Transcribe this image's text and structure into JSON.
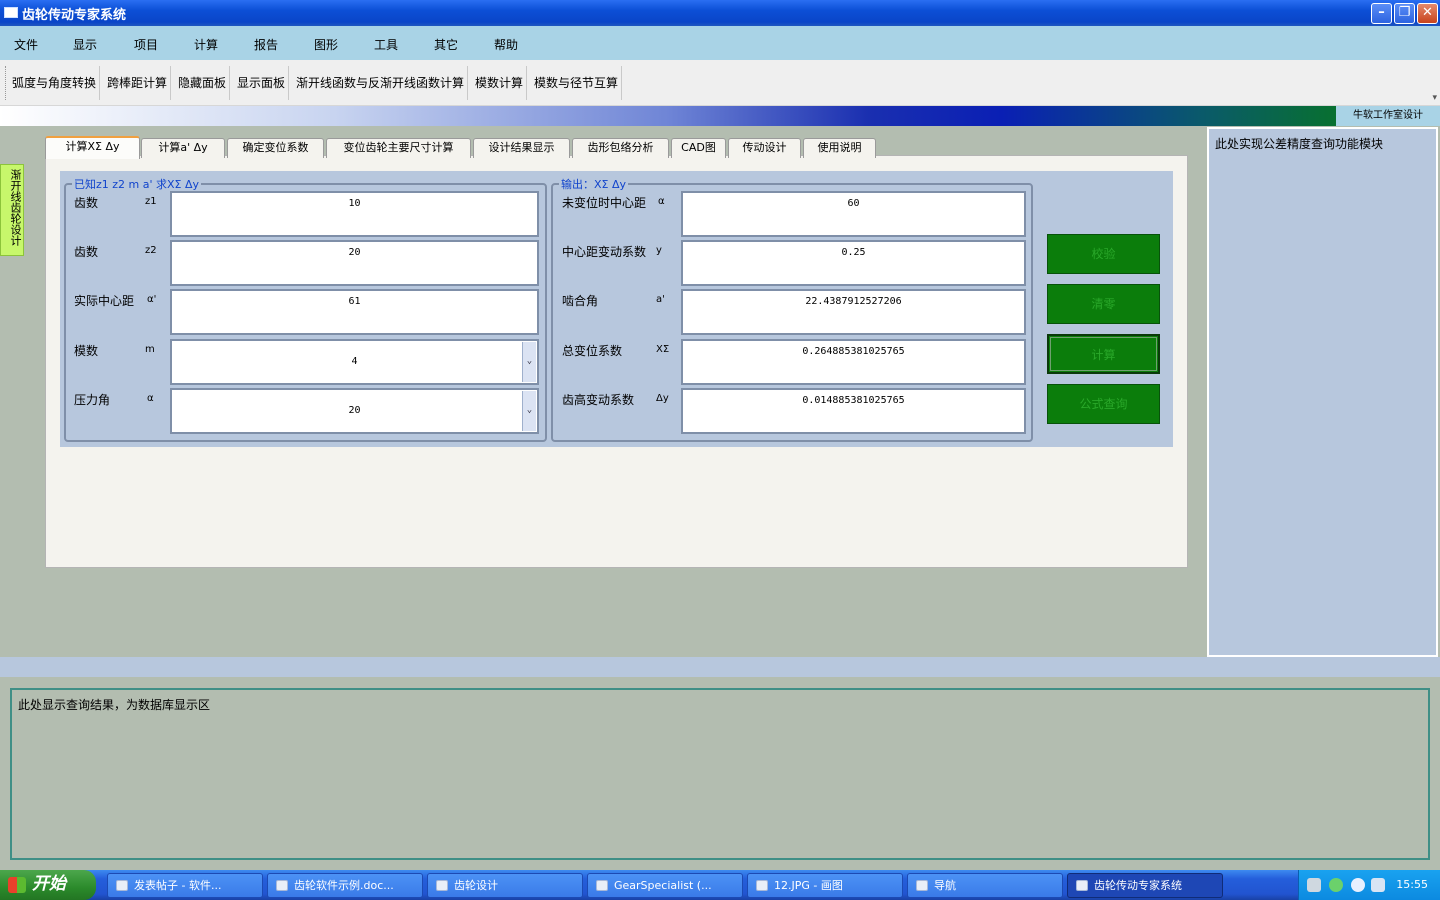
{
  "window": {
    "title": "齿轮传动专家系统"
  },
  "menu": [
    "文件",
    "显示",
    "项目",
    "计算",
    "报告",
    "图形",
    "工具",
    "其它",
    "帮助"
  ],
  "toolbar": [
    "弧度与角度转换",
    "跨棒距计算",
    "隐藏面板",
    "显示面板",
    "渐开线函数与反渐开线函数计算",
    "模数计算",
    "模数与径节互算"
  ],
  "studio_label": "牛软工作室设计",
  "left_tab": "渐开线齿轮设计",
  "tabs": [
    "计算XΣ Δy",
    "计算a' Δy",
    "确定变位系数",
    "变位齿轮主要尺寸计算",
    "设计结果显示",
    "齿形包络分析",
    "CAD图",
    "传动设计",
    "使用说明"
  ],
  "input_group": {
    "legend": "已知z1 z2 m a' 求XΣ Δy",
    "rows": [
      {
        "label": "齿数",
        "symbol": "z1",
        "value": "10"
      },
      {
        "label": "齿数",
        "symbol": "z2",
        "value": "20"
      },
      {
        "label": "实际中心距",
        "symbol": "α'",
        "value": "61"
      },
      {
        "label": "模数",
        "symbol": "m",
        "value": "4"
      },
      {
        "label": "压力角",
        "symbol": "α",
        "value": "20"
      }
    ]
  },
  "output_group": {
    "legend": "输出：XΣ Δy",
    "rows": [
      {
        "label": "未变位时中心距",
        "symbol": "α",
        "value": "60"
      },
      {
        "label": "中心距变动系数",
        "symbol": "y",
        "value": "0.25"
      },
      {
        "label": "啮合角",
        "symbol": "a'",
        "value": "22.4387912527206"
      },
      {
        "label": "总变位系数",
        "symbol": "XΣ",
        "value": "0.264885381025765"
      },
      {
        "label": "齿高变动系数",
        "symbol": "Δy",
        "value": "0.014885381025765"
      }
    ]
  },
  "buttons": {
    "verify": "校验",
    "clear": "清零",
    "calculate": "计算",
    "formula": "公式查询"
  },
  "right_panel_text": "此处实现公差精度查询功能模块",
  "bottom_panel_text": "此处显示查询结果，为数据库显示区",
  "taskbar": {
    "start": "开始",
    "tasks": [
      "发表帖子 - 软件...",
      "齿轮软件示例.doc...",
      "齿轮设计",
      "GearSpecialist (...",
      "12.JPG - 画图",
      "导航",
      "齿轮传动专家系统"
    ],
    "clock": "15:55"
  }
}
